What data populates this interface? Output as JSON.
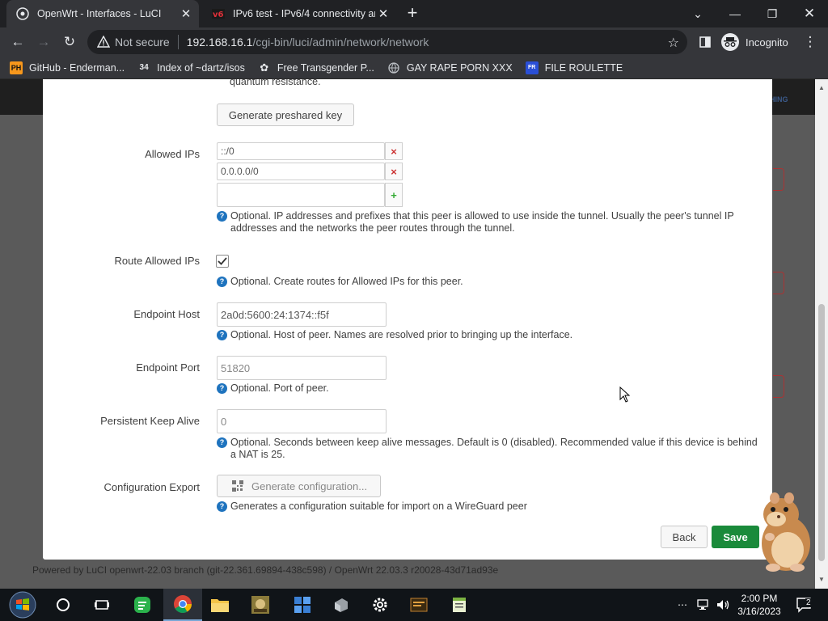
{
  "browser": {
    "tabs": [
      {
        "title": "OpenWrt - Interfaces - LuCI",
        "active": true
      },
      {
        "title": "IPv6 test - IPv6/4 connectivity and",
        "active": false
      }
    ],
    "security_label": "Not secure",
    "url_host": "192.168.16.1",
    "url_path": "/cgi-bin/luci/admin/network/network",
    "profile_label": "Incognito",
    "bookmarks": [
      {
        "icon": "ph-icon",
        "label": "GitHub - Enderman..."
      },
      {
        "icon": "globe-icon",
        "label": "Index of ~dartz/isos"
      },
      {
        "icon": "paw-icon",
        "label": "Free Transgender P..."
      },
      {
        "icon": "globe-icon",
        "label": "GAY RAPE PORN XXX"
      },
      {
        "icon": "file-icon",
        "label": "FILE ROULETTE"
      }
    ]
  },
  "modal": {
    "cutoff_text": "quantum resistance.",
    "preshared_button": "Generate preshared key",
    "allowed_ips": {
      "label": "Allowed IPs",
      "values": [
        "::/0",
        "0.0.0.0/0"
      ],
      "remove_symbol": "×",
      "add_symbol": "+",
      "hint": "Optional. IP addresses and prefixes that this peer is allowed to use inside the tunnel. Usually the peer's tunnel IP addresses and the networks the peer routes through the tunnel."
    },
    "route_allowed_ips": {
      "label": "Route Allowed IPs",
      "checked": true,
      "hint": "Optional. Create routes for Allowed IPs for this peer."
    },
    "endpoint_host": {
      "label": "Endpoint Host",
      "value": "2a0d:5600:24:1374::f5f",
      "hint": "Optional. Host of peer. Names are resolved prior to bringing up the interface."
    },
    "endpoint_port": {
      "label": "Endpoint Port",
      "placeholder": "51820",
      "hint": "Optional. Port of peer."
    },
    "keepalive": {
      "label": "Persistent Keep Alive",
      "placeholder": "0",
      "hint": "Optional. Seconds between keep alive messages. Default is 0 (disabled). Recommended value if this device is behind a NAT is 25."
    },
    "config_export": {
      "label": "Configuration Export",
      "button": "Generate configuration...",
      "hint": "Generates a configuration suitable for import on a WireGuard peer"
    },
    "back_button": "Back",
    "save_button": "Save"
  },
  "background_footer": "Powered by LuCI openwrt-22.03 branch (git-22.361.69894-438c598) / OpenWrt 22.03.3 r20028-43d71ad93e",
  "background_tag": "HING",
  "taskbar": {
    "time": "2:00 PM",
    "date": "3/16/2023",
    "notification_count": "2"
  },
  "colors": {
    "save_green": "#1a8a3a",
    "hint_blue": "#1e73be",
    "remove_red": "#cc3333",
    "add_green": "#33aa33"
  }
}
